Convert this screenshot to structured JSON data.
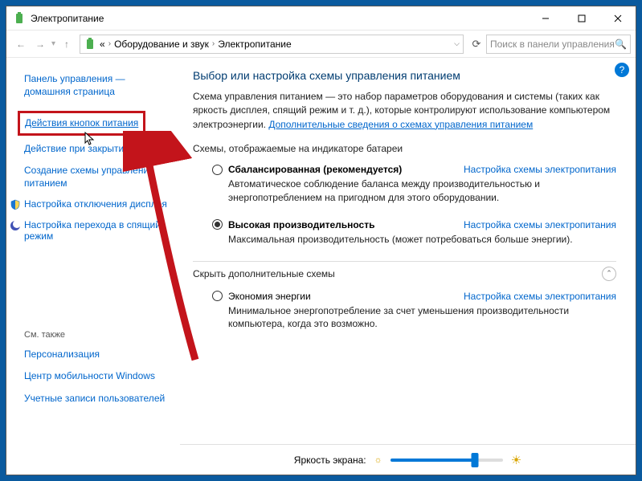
{
  "window_title": "Электропитание",
  "nav": {
    "back": "←",
    "fwd": "→",
    "up": "↑",
    "breadcrumb_prefix": "«",
    "crumb1": "Оборудование и звук",
    "crumb2": "Электропитание",
    "search_placeholder": "Поиск в панели управления"
  },
  "sidebar": {
    "home": "Панель управления — домашняя страница",
    "items": [
      "Действия кнопок питания",
      "Действие при закрытии крышки",
      "Создание схемы управления питанием",
      "Настройка отключения дисплея",
      "Настройка перехода в спящий режим"
    ],
    "see_also": "См. также",
    "see_links": [
      "Персонализация",
      "Центр мобильности Windows",
      "Учетные записи пользователей"
    ]
  },
  "main": {
    "heading": "Выбор или настройка схемы управления питанием",
    "desc": "Схема управления питанием — это набор параметров оборудования и системы (таких как яркость дисплея, спящий режим и т. д.), которые контролируют использование компьютером электроэнергии. ",
    "desc_link": "Дополнительные сведения о схемах управления питанием",
    "sub1": "Схемы, отображаемые на индикаторе батареи",
    "plan_link": "Настройка схемы электропитания",
    "plans": [
      {
        "name": "Сбалансированная (рекомендуется)",
        "desc": "Автоматическое соблюдение баланса между производительностью и энергопотреблением на пригодном для этого оборудовании.",
        "selected": false
      },
      {
        "name": "Высокая производительность",
        "desc": "Максимальная производительность (может потребоваться больше энергии).",
        "selected": true
      }
    ],
    "hide": "Скрыть дополнительные схемы",
    "extra_plan": {
      "name": "Экономия энергии",
      "desc": "Минимальное энергопотребление за счет уменьшения производительности компьютера, когда это возможно.",
      "selected": false
    },
    "brightness_label": "Яркость экрана:"
  }
}
